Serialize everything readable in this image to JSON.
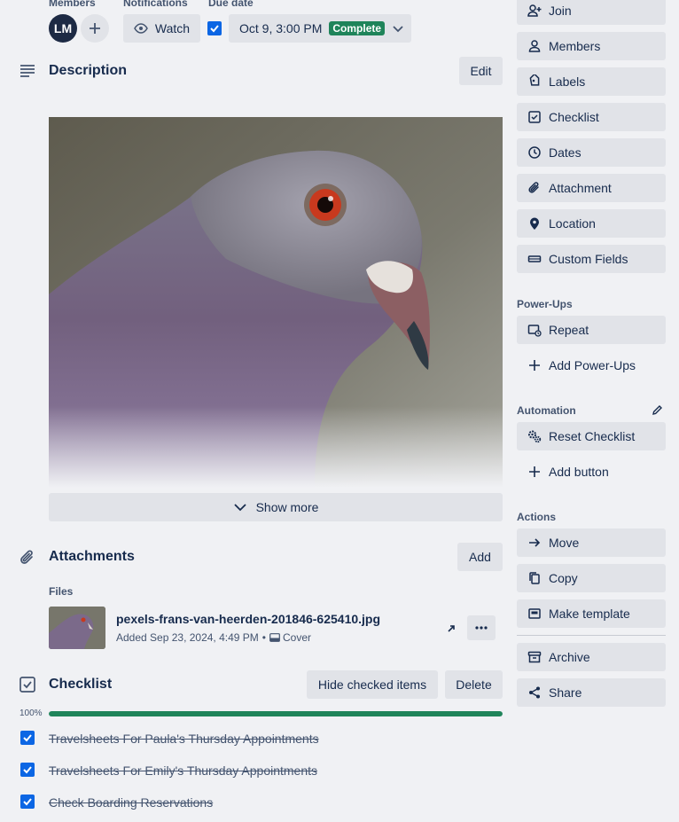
{
  "header": {
    "members_label": "Members",
    "member_initials": "LM",
    "notifications_label": "Notifications",
    "watch_label": "Watch",
    "due_date_label": "Due date",
    "due_date_value": "Oct 9, 3:00 PM",
    "due_status": "Complete"
  },
  "description": {
    "title": "Description",
    "edit_label": "Edit",
    "show_more_label": "Show more"
  },
  "attachments": {
    "title": "Attachments",
    "add_label": "Add",
    "files_label": "Files",
    "file_name": "pexels-frans-van-heerden-201846-625410.jpg",
    "file_added": "Added Sep 23, 2024, 4:49 PM",
    "file_separator": "•",
    "cover_label": "Cover"
  },
  "checklist": {
    "title": "Checklist",
    "hide_label": "Hide checked items",
    "delete_label": "Delete",
    "progress_text": "100%",
    "progress": 1.0,
    "items": [
      "Travelsheets For Paula's Thursday Appointments",
      "Travelsheets For Emily's Thursday Appointments",
      "Check Boarding Reservations"
    ]
  },
  "sidebar": {
    "join": "Join",
    "members": "Members",
    "labels": "Labels",
    "checklist": "Checklist",
    "dates": "Dates",
    "attachment": "Attachment",
    "location": "Location",
    "custom_fields": "Custom Fields",
    "powerups_head": "Power-Ups",
    "repeat": "Repeat",
    "add_powerups": "Add Power-Ups",
    "automation_head": "Automation",
    "reset_checklist": "Reset Checklist",
    "add_button": "Add button",
    "actions_head": "Actions",
    "move": "Move",
    "copy": "Copy",
    "make_template": "Make template",
    "archive": "Archive",
    "share": "Share"
  },
  "colors": {
    "accent": "#0c66e4",
    "complete": "#1f845a",
    "progress": "#1f845a",
    "button_bg": "#e1e3e8",
    "page_bg": "#f0f1f4"
  }
}
